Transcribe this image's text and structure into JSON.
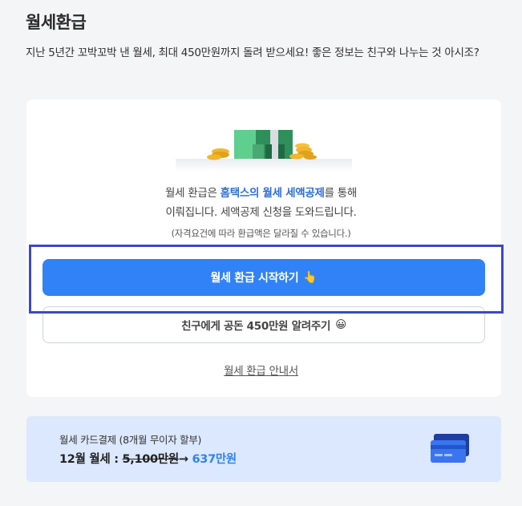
{
  "header": {
    "title": "월세환급",
    "description": "지난 5년간 꼬박꼬박 낸 월세, 최대 450만원까지 돌려 받으세요! 좋은 정보는 친구와 나누는 것 아시조?"
  },
  "card": {
    "illustration": "money-stack-icon",
    "info_prefix": "월세 환급은 ",
    "info_highlight": "홈택스의 월세 세액공제",
    "info_suffix": "를 통해",
    "info_line2": "이뤄집니다. 세액공제 신청을 도와드립니다.",
    "note": "(자격요건에 따라 환급액은 달라질 수 있습니다.)",
    "start_button": "월세 환급 시작하기",
    "start_button_emoji": "👆",
    "share_button": "친구에게 공돈 450만원 알려주기",
    "share_button_emoji": "😀",
    "guide_link": "월세 환급 안내서"
  },
  "banner": {
    "title": "월세 카드결제 (8개월 무이자 할부)",
    "price_prefix": "12월 월세 : ",
    "price_old": "5,100만원",
    "arrow": "→",
    "price_new": "637만원",
    "icon": "credit-card-icon"
  },
  "colors": {
    "accent": "#3182f6",
    "highlight_box": "#3d49c4",
    "banner_bg": "#dbe8fd"
  }
}
